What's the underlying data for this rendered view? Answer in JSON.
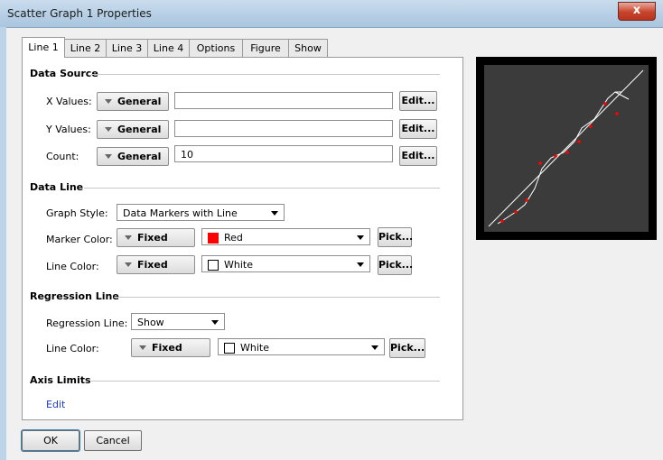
{
  "window": {
    "title": "Scatter Graph 1 Properties",
    "close_label": "x"
  },
  "tabs": [
    "Line 1",
    "Line 2",
    "Line 3",
    "Line 4",
    "Options",
    "Figure",
    "Show"
  ],
  "data_source": {
    "heading": "Data Source",
    "x_values": {
      "label": "X Values:",
      "mode": "General",
      "value": "",
      "edit": "Edit..."
    },
    "y_values": {
      "label": "Y Values:",
      "mode": "General",
      "value": "",
      "edit": "Edit..."
    },
    "count": {
      "label": "Count:",
      "mode": "General",
      "value": "10",
      "edit": "Edit..."
    }
  },
  "data_line": {
    "heading": "Data Line",
    "graph_style": {
      "label": "Graph Style:",
      "value": "Data Markers with Line"
    },
    "marker_color": {
      "label": "Marker Color:",
      "mode": "Fixed",
      "value": "Red",
      "swatch": "#ff0000",
      "pick": "Pick..."
    },
    "line_color": {
      "label": "Line Color:",
      "mode": "Fixed",
      "value": "White",
      "swatch": "#ffffff",
      "pick": "Pick..."
    }
  },
  "regression_line": {
    "heading": "Regression Line",
    "regression": {
      "label": "Regression Line:",
      "value": "Show"
    },
    "line_color": {
      "label": "Line Color:",
      "mode": "Fixed",
      "value": "White",
      "swatch": "#ffffff",
      "pick": "Pick..."
    }
  },
  "axis_limits": {
    "heading": "Axis Limits",
    "edit_link": "Edit"
  },
  "buttons": {
    "ok": "OK",
    "cancel": "Cancel"
  },
  "preview": {
    "background": "#3b3b3b",
    "line_color": "#ffffff",
    "marker_color": "#ff0000"
  }
}
